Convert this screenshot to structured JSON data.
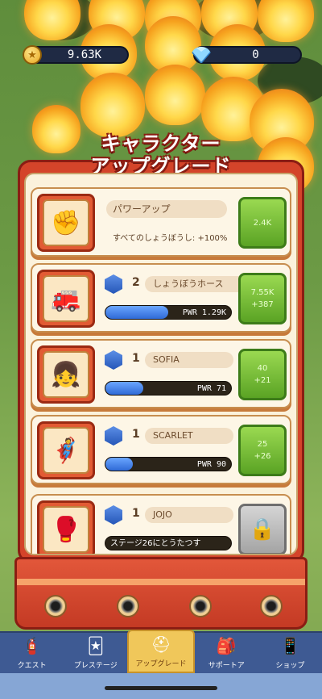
{
  "currency": {
    "coins": "9.63K",
    "gems": "0"
  },
  "title": {
    "line1": "キャラクター",
    "line2": "アップグレード"
  },
  "power_card": {
    "title": "パワーアップ",
    "desc": "すべてのしょうぼうし: +100%",
    "cost": "2.4K"
  },
  "cards": [
    {
      "level": "2",
      "name": "しょうぼうホース",
      "power": "PWR 1.29K",
      "progress": 0.5,
      "cost": "7.55K",
      "gain": "+387"
    },
    {
      "level": "1",
      "name": "SOFIA",
      "power": "PWR 71",
      "progress": 0.3,
      "cost": "40",
      "gain": "+21"
    },
    {
      "level": "1",
      "name": "SCARLET",
      "power": "PWR 90",
      "progress": 0.22,
      "cost": "25",
      "gain": "+26"
    },
    {
      "level": "1",
      "name": "JOJO",
      "power": "ステージ26にとうたつす",
      "progress": 0.0,
      "locked": true
    }
  ],
  "tabs": [
    {
      "label": "クエスト",
      "icon": "quest-icon"
    },
    {
      "label": "プレステージ",
      "icon": "prestige-icon"
    },
    {
      "label": "アップグレード",
      "icon": "upgrade-icon",
      "active": true
    },
    {
      "label": "サポートア",
      "icon": "support-icon"
    },
    {
      "label": "ショップ",
      "icon": "shop-icon"
    }
  ]
}
